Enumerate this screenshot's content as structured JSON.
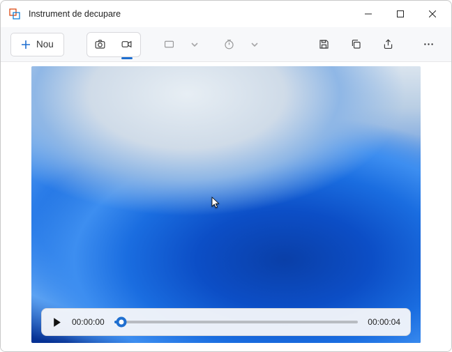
{
  "window": {
    "title": "Instrument de decupare"
  },
  "toolbar": {
    "new_label": "Nou",
    "icons": {
      "camera": "camera-icon",
      "video": "video-icon",
      "shape": "rectangle-mode-icon",
      "delay": "delay-timer-icon",
      "save": "save-icon",
      "copy": "copy-icon",
      "share": "share-icon",
      "more": "more-icon"
    }
  },
  "player": {
    "current_time": "00:00:00",
    "duration": "00:00:04",
    "progress_percent": 3
  }
}
